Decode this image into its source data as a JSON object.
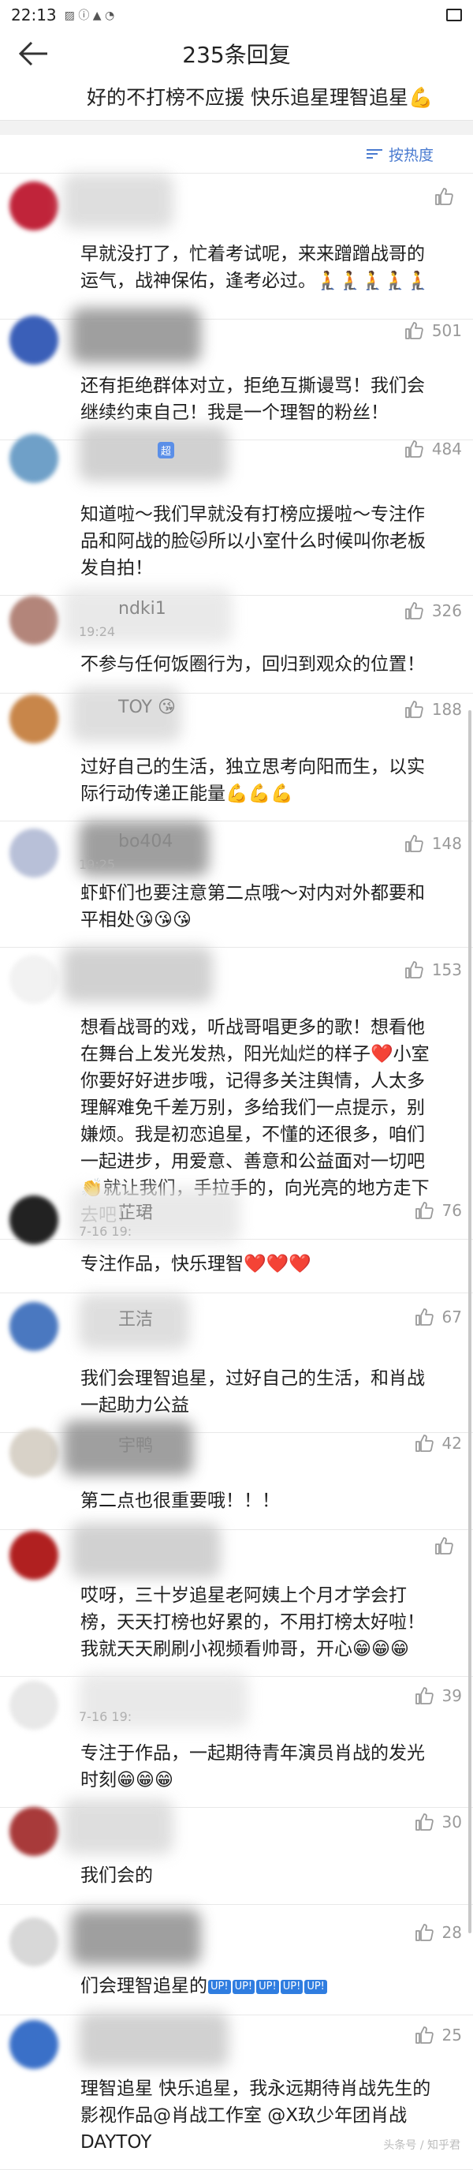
{
  "status": {
    "time": "22:13"
  },
  "header": {
    "title": "235条回复"
  },
  "post": {
    "text": "好的不打榜不应援 快乐追星理智追星💪"
  },
  "sort": {
    "label": "按热度"
  },
  "comments": [
    {
      "name": "",
      "badge": "",
      "time": "",
      "likes": "",
      "text": "早就没打了，忙着考试呢，来来蹭蹭战哥的运气，战神保佑，逢考必过。🧎🧎🧎🧎🧎",
      "avatar_color": "#c0243a"
    },
    {
      "name": "",
      "badge": "",
      "time": "",
      "likes": "501",
      "text": "还有拒绝群体对立，拒绝互撕谩骂！我们会继续约束自己！我是一个理智的粉丝！",
      "avatar_color": "#3a5fb8"
    },
    {
      "name": "",
      "badge": "超",
      "time": "",
      "likes": "484",
      "text": "知道啦～我们早就没有打榜应援啦～专注作品和阿战的脸🐱所以小室什么时候叫你老板发自拍！",
      "avatar_color": "#6fa0c8"
    },
    {
      "name": "ndki1",
      "badge": "",
      "time": "19:24",
      "likes": "326",
      "text": "不参与任何饭圈行为，回归到观众的位置！",
      "avatar_color": "#b3857a"
    },
    {
      "name": "TOY 😘",
      "badge": "",
      "time": "",
      "likes": "188",
      "text": "过好自己的生活，独立思考向阳而生，以实际行动传递正能量💪💪💪",
      "avatar_color": "#c8864a"
    },
    {
      "name": "bo404",
      "badge": "",
      "time": "19:25",
      "likes": "148",
      "text": "虾虾们也要注意第二点哦～对内对外都要和平相处😘😘😘",
      "avatar_color": "#b8c0d8"
    },
    {
      "name": "",
      "badge": "",
      "time": "",
      "likes": "153",
      "text": "想看战哥的戏，听战哥唱更多的歌！想看他在舞台上发光发热，阳光灿烂的样子❤️小室你要好好进步哦，记得多关注舆情，人太多理解难免千差万别，多给我们一点提示，别嫌烦。我是初恋追星，不懂的还很多，咱们一起进步，用爱意、善意和公益面对一切吧👏就让我们，手拉手的，向光亮的地方走下去吧！",
      "avatar_color": "#f2f2f2"
    },
    {
      "name": "芷珺",
      "badge": "",
      "time": "7-16 19:",
      "likes": "76",
      "text": "专注作品，快乐理智❤️❤️❤️",
      "avatar_color": "#222222"
    },
    {
      "name": "王洁",
      "badge": "",
      "time": "",
      "likes": "67",
      "text": "我们会理智追星，过好自己的生活，和肖战一起助力公益",
      "avatar_color": "#4a78c0"
    },
    {
      "name": "宇鸭",
      "badge": "",
      "time": "",
      "likes": "42",
      "text": "第二点也很重要哦！！！",
      "avatar_color": "#d8d2c8"
    },
    {
      "name": "",
      "badge": "",
      "time": "",
      "likes": "",
      "text": "哎呀，三十岁追星老阿姨上个月才学会打榜，天天打榜也好累的，不用打榜太好啦！我就天天刷刷小视频看帅哥，开心😁😁😁",
      "avatar_color": "#b02020"
    },
    {
      "name": "",
      "badge": "",
      "time": "7-16 19:",
      "likes": "39",
      "text": "专注于作品，一起期待青年演员肖战的发光时刻😁😁😁",
      "avatar_color": "#e8e8e8"
    },
    {
      "name": "",
      "badge": "",
      "time": "",
      "likes": "30",
      "text": "我们会的",
      "avatar_color": "#a83a3a"
    },
    {
      "name": "",
      "badge": "",
      "time": "",
      "likes": "28",
      "text": "们会理智追星的",
      "avatar_color": "#d8d8d8"
    },
    {
      "name": "",
      "badge": "",
      "time": "",
      "likes": "25",
      "text": "理智追星 快乐追星，我永远期待肖战先生的影视作品@肖战工作室 @X玖少年团肖战DAYTOY",
      "avatar_color": "#3a70c8"
    }
  ],
  "hashtags": [
    "UP!",
    "UP!",
    "UP!",
    "UP!",
    "UP!"
  ],
  "watermark": "头条号 / 知乎君"
}
